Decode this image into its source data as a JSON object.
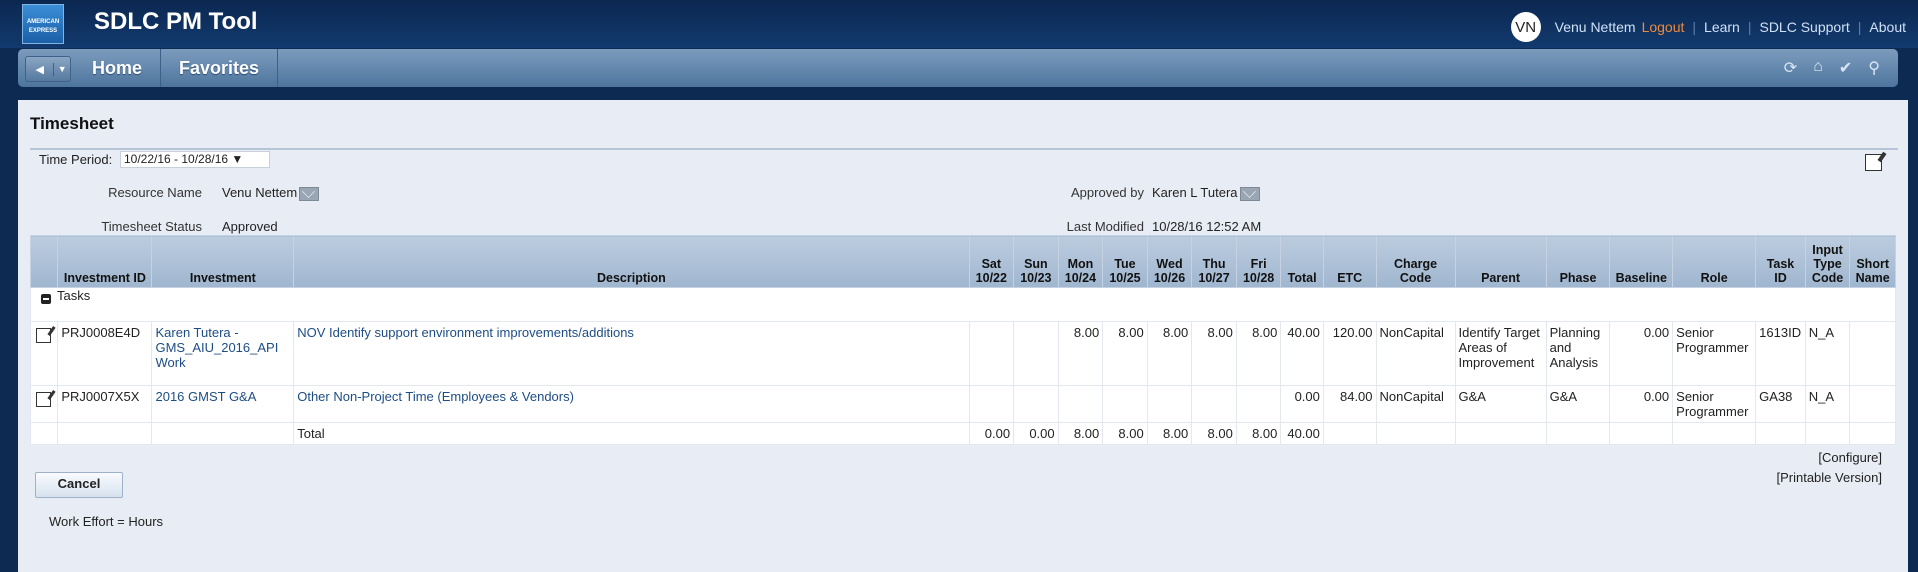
{
  "topbar": {
    "logo_text": "AMERICAN EXPRESS",
    "app_title": "SDLC PM Tool",
    "avatar_initials": "VN",
    "user_name": "Venu Nettem",
    "logout": "Logout",
    "learn": "Learn",
    "support": "SDLC Support",
    "about": "About"
  },
  "navbar": {
    "back": "◀",
    "back_menu": "▼",
    "home": "Home",
    "favorites": "Favorites",
    "icons": [
      "refresh-icon",
      "home-icon",
      "check-icon",
      "search-icon"
    ]
  },
  "page": {
    "title": "Timesheet",
    "time_period_label": "Time Period:",
    "time_period_value": "10/22/16 - 10/28/16 ▼",
    "resource_name_label": "Resource Name",
    "resource_name": "Venu Nettem",
    "approved_by_label": "Approved by",
    "approved_by": "Karen L Tutera",
    "status_label": "Timesheet Status",
    "status": "Approved",
    "last_modified_label": "Last Modified",
    "last_modified": "10/28/16 12:52 AM"
  },
  "table": {
    "headers": {
      "investment_id": "Investment ID",
      "investment": "Investment",
      "description": "Description",
      "sat": "Sat 10/22",
      "sun": "Sun 10/23",
      "mon": "Mon 10/24",
      "tue": "Tue 10/25",
      "wed": "Wed 10/26",
      "thu": "Thu 10/27",
      "fri": "Fri 10/28",
      "total": "Total",
      "etc": "ETC",
      "charge_code": "Charge Code",
      "parent": "Parent",
      "phase": "Phase",
      "baseline": "Baseline",
      "role": "Role",
      "task_id": "Task ID",
      "input_type_code": "Input Type Code",
      "short_name": "Short Name"
    },
    "group_label": "Tasks",
    "rows": [
      {
        "investment_id": "PRJ0008E4D",
        "investment": "Karen Tutera - GMS_AIU_2016_API Work",
        "description": "NOV Identify support environment improvements/additions",
        "sat": "",
        "sun": "",
        "mon": "8.00",
        "tue": "8.00",
        "wed": "8.00",
        "thu": "8.00",
        "fri": "8.00",
        "total": "40.00",
        "etc": "120.00",
        "charge_code": "NonCapital",
        "parent": "Identify Target Areas of Improvement",
        "phase": "Planning and Analysis",
        "baseline": "0.00",
        "role": "Senior Programmer",
        "task_id": "1613ID",
        "input_type_code": "N_A",
        "short_name": ""
      },
      {
        "investment_id": "PRJ0007X5X",
        "investment": "2016 GMST G&A",
        "description": "Other Non-Project Time (Employees & Vendors)",
        "sat": "",
        "sun": "",
        "mon": "",
        "tue": "",
        "wed": "",
        "thu": "",
        "fri": "",
        "total": "0.00",
        "etc": "84.00",
        "charge_code": "NonCapital",
        "parent": "G&A",
        "phase": "G&A",
        "baseline": "0.00",
        "role": "Senior Programmer",
        "task_id": "GA38",
        "input_type_code": "N_A",
        "short_name": ""
      }
    ],
    "totals": {
      "label": "Total",
      "sat": "0.00",
      "sun": "0.00",
      "mon": "8.00",
      "tue": "8.00",
      "wed": "8.00",
      "thu": "8.00",
      "fri": "8.00",
      "total": "40.00"
    }
  },
  "links": {
    "configure": "[Configure]",
    "printable": "[Printable Version]"
  },
  "actions": {
    "cancel": "Cancel"
  },
  "footnote": "Work Effort = Hours"
}
